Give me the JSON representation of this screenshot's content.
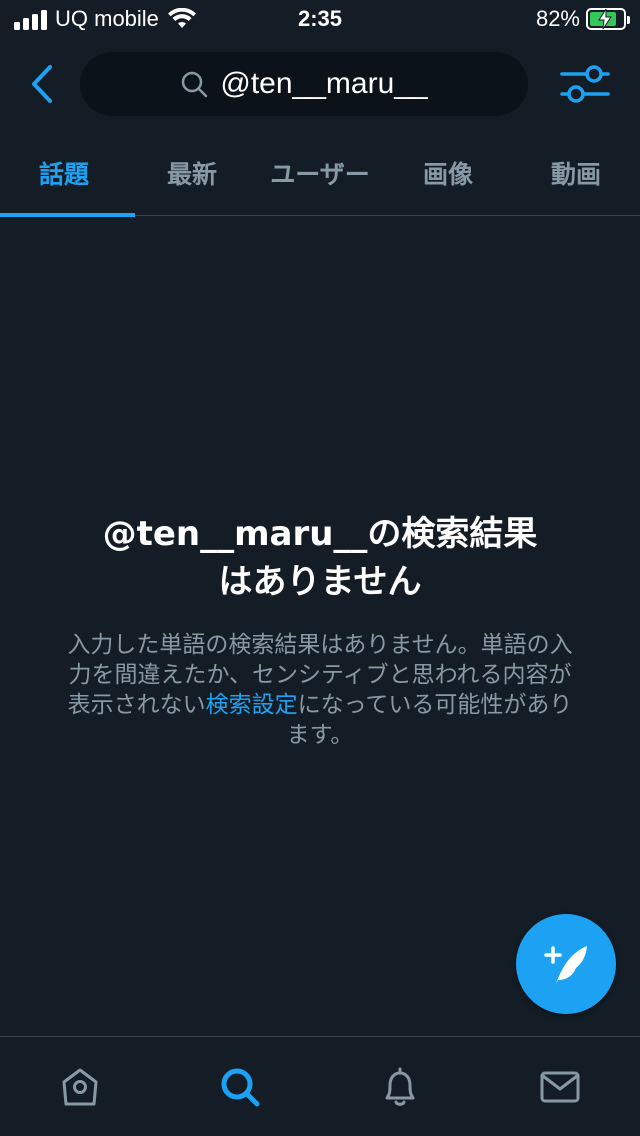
{
  "status_bar": {
    "carrier": "UQ mobile",
    "time": "2:35",
    "battery_percent": "82%",
    "battery_level": 0.82,
    "battery_color": "#35c759"
  },
  "header": {
    "back_icon": "chevron-left-icon",
    "search": {
      "icon": "search-icon",
      "value": "@ten__maru__"
    },
    "filter_icon": "sliders-icon"
  },
  "tabs": [
    {
      "label": "話題",
      "active": true
    },
    {
      "label": "最新",
      "active": false
    },
    {
      "label": "ユーザー",
      "active": false
    },
    {
      "label": "画像",
      "active": false
    },
    {
      "label": "動画",
      "active": false
    }
  ],
  "empty_state": {
    "title_line1": "@ten__maru__の検索結果",
    "title_line2": "はありません",
    "body_before_link": "入力した単語の検索結果はありません。単語の入力を間違えたか、センシティブと思われる内容が表示されない",
    "body_link": "検索設定",
    "body_after_link": "になっている可能性があります。"
  },
  "fab": {
    "icon": "compose-tweet-icon"
  },
  "bottom_nav": [
    {
      "name": "home",
      "icon": "home-icon",
      "active": false
    },
    {
      "name": "search",
      "icon": "search-icon",
      "active": true
    },
    {
      "name": "notifications",
      "icon": "bell-icon",
      "active": false
    },
    {
      "name": "messages",
      "icon": "envelope-icon",
      "active": false
    }
  ],
  "colors": {
    "background": "#141d26",
    "accent": "#1da1f2",
    "secondary_text": "#8899a6",
    "divider": "#38444d",
    "search_field": "#0c121a"
  }
}
